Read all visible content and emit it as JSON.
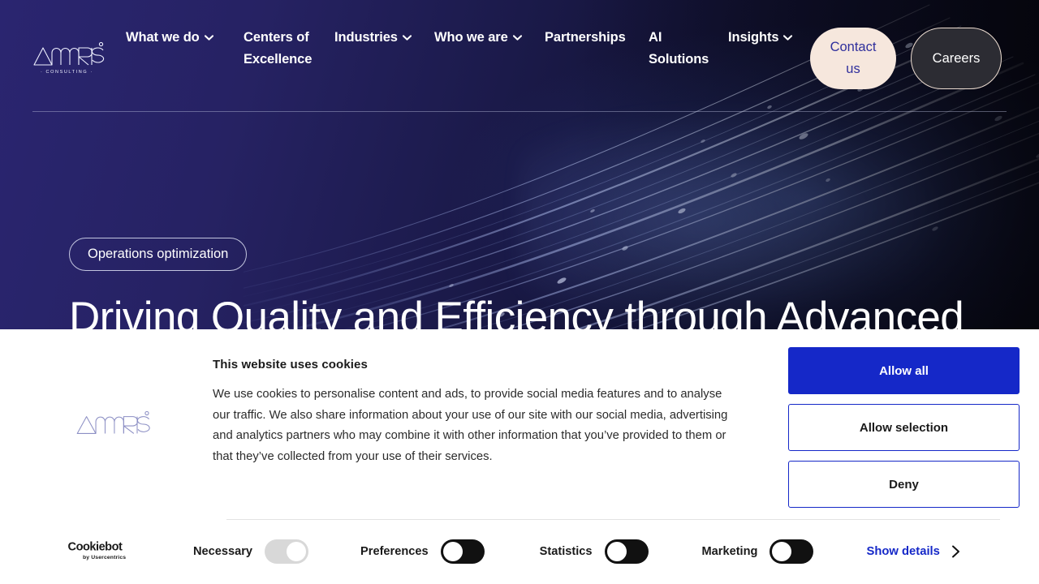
{
  "header": {
    "logo_alt": "Amaris Consulting",
    "nav": [
      {
        "label": "What we do",
        "has_dropdown": true
      },
      {
        "label": "Centers of Excellence",
        "has_dropdown": false
      },
      {
        "label": "Industries",
        "has_dropdown": true
      },
      {
        "label": "Who we are",
        "has_dropdown": true
      },
      {
        "label": "Partnerships",
        "has_dropdown": false
      },
      {
        "label": "AI Solutions",
        "has_dropdown": false
      },
      {
        "label": "Insights",
        "has_dropdown": true
      }
    ],
    "contact_label": "Contact us",
    "careers_label": "Careers",
    "contact_bg": "#f6e7dd",
    "contact_text": "#2f2f9c",
    "careers_bg": "#2c2c33",
    "careers_border": "#efdfd3"
  },
  "hero": {
    "tag": "Operations optimization",
    "title": "Driving Quality and Efficiency through Advanced",
    "bg_color_left": "#2a2570",
    "bg_color_right": "#07070f"
  },
  "cookie_banner": {
    "brand_alt": "Amaris",
    "title": "This website uses cookies",
    "body": "We use cookies to personalise content and ads, to provide social media features and to analyse our traffic. We also share information about your use of our site with our social media, advertising and analytics partners who may combine it with other information that you’ve provided to them or that they’ve collected from your use of their services.",
    "buttons": [
      {
        "label": "Allow all",
        "style": "primary"
      },
      {
        "label": "Allow selection",
        "style": "ghost"
      },
      {
        "label": "Deny",
        "style": "ghost"
      }
    ],
    "accent_color": "#1528c8",
    "consent_provider": "Cookiebot",
    "consent_provider_sub": "by Usercentrics",
    "categories": [
      {
        "label": "Necessary",
        "state": "locked"
      },
      {
        "label": "Preferences",
        "state": "off"
      },
      {
        "label": "Statistics",
        "state": "off"
      },
      {
        "label": "Marketing",
        "state": "off"
      }
    ],
    "show_details_label": "Show details"
  }
}
